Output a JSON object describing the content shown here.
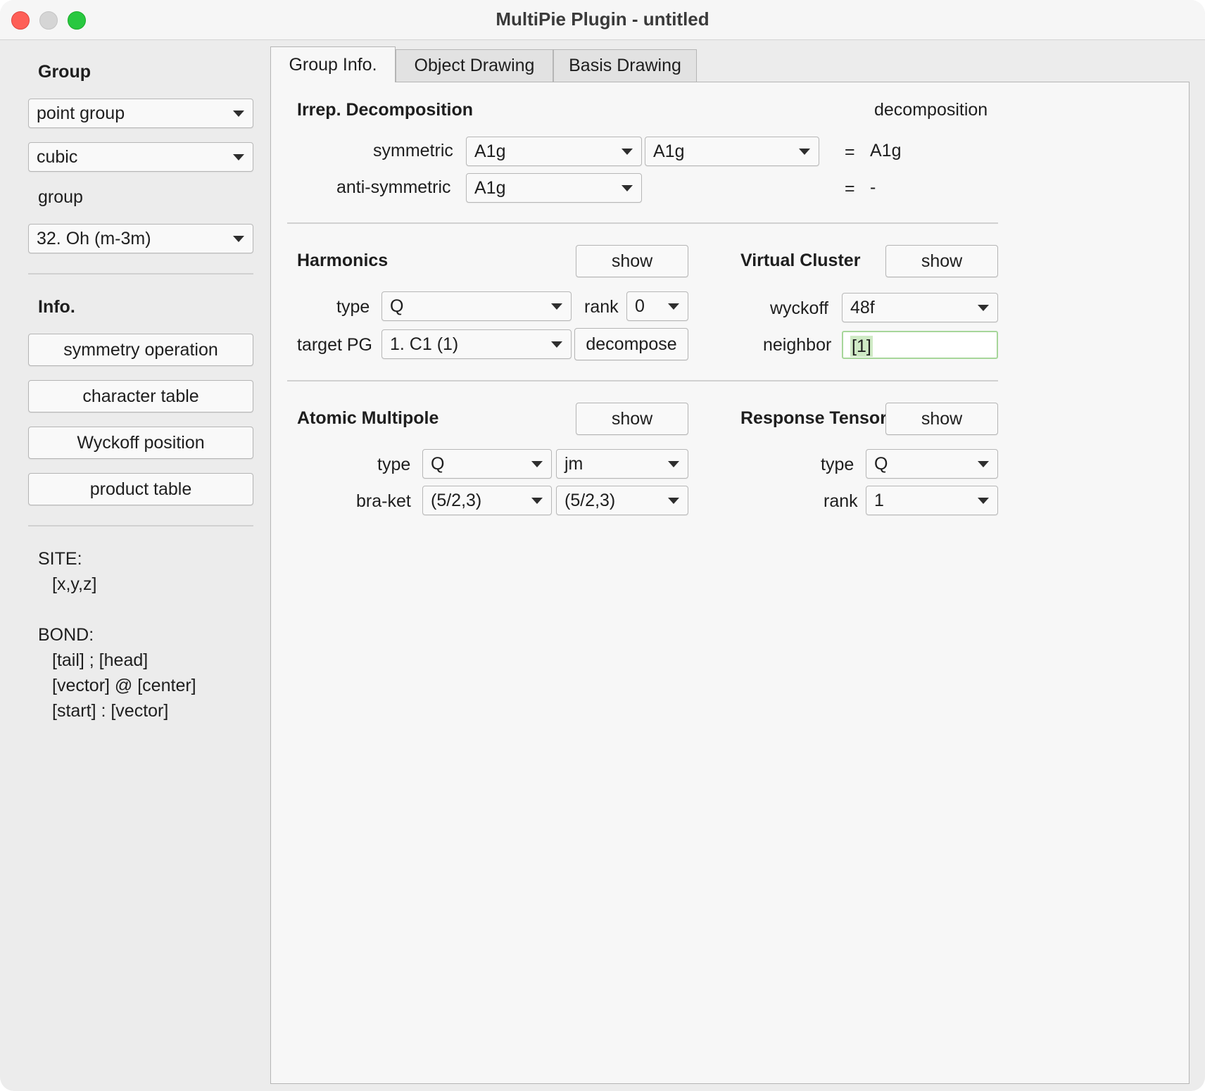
{
  "window": {
    "title": "MultiPie Plugin - untitled"
  },
  "sidebar": {
    "group_heading": "Group",
    "group_type": "point group",
    "crystal_system": "cubic",
    "group_label": "group",
    "group_value": "32. Oh (m-3m)",
    "info_heading": "Info.",
    "buttons": [
      "symmetry operation",
      "character table",
      "Wyckoff position",
      "product table"
    ],
    "site_label": "SITE:",
    "site_format": "[x,y,z]",
    "bond_label": "BOND:",
    "bond_formats": [
      "[tail] ; [head]",
      "[vector] @ [center]",
      "[start] : [vector]"
    ]
  },
  "tabs": [
    "Group Info.",
    "Object Drawing",
    "Basis Drawing"
  ],
  "irrep": {
    "heading": "Irrep. Decomposition",
    "result_heading": "decomposition",
    "symmetric_label": "symmetric",
    "symmetric_a": "A1g",
    "symmetric_b": "A1g",
    "symmetric_eq": "=",
    "symmetric_result": "A1g",
    "antisymmetric_label": "anti-symmetric",
    "antisymmetric_a": "A1g",
    "antisymmetric_eq": "=",
    "antisymmetric_result": "-"
  },
  "harmonics": {
    "heading": "Harmonics",
    "show_label": "show",
    "type_label": "type",
    "type_value": "Q",
    "rank_label": "rank",
    "rank_value": "0",
    "target_label": "target PG",
    "target_value": "1. C1 (1)",
    "decompose_label": "decompose"
  },
  "virtual_cluster": {
    "heading": "Virtual Cluster",
    "show_label": "show",
    "wyckoff_label": "wyckoff",
    "wyckoff_value": "48f",
    "neighbor_label": "neighbor",
    "neighbor_value": "[1]"
  },
  "atomic_multipole": {
    "heading": "Atomic Multipole",
    "show_label": "show",
    "type_label": "type",
    "type_value": "Q",
    "basis_value": "jm",
    "braket_label": "bra-ket",
    "bra_value": "(5/2,3)",
    "ket_value": "(5/2,3)"
  },
  "response_tensor": {
    "heading": "Response Tensor",
    "show_label": "show",
    "type_label": "type",
    "type_value": "Q",
    "rank_label": "rank",
    "rank_value": "1"
  }
}
